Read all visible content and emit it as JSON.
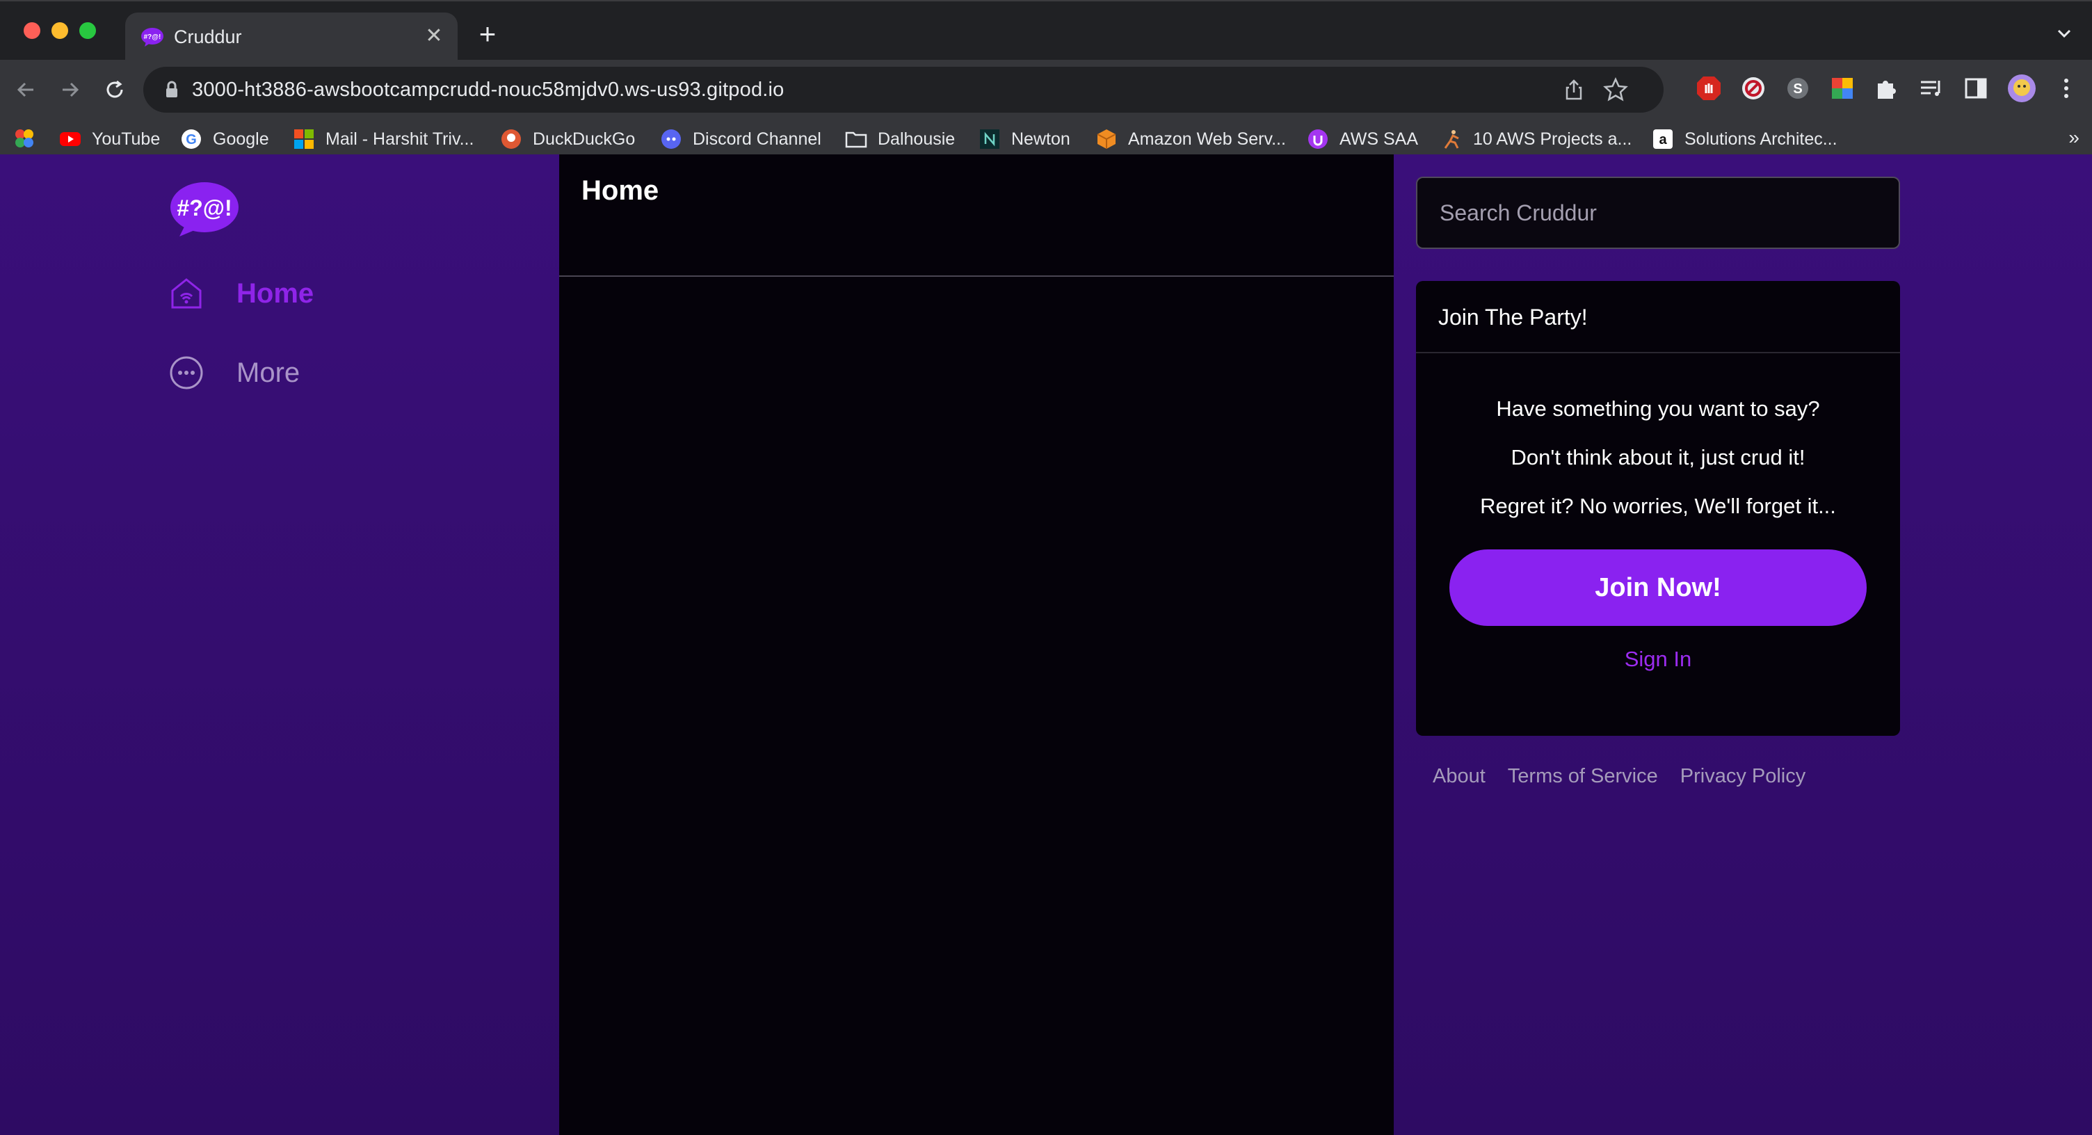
{
  "browser": {
    "tab_title": "Cruddur",
    "url": "3000-ht3886-awsbootcampcrudd-nouc58mjdv0.ws-us93.gitpod.io",
    "bookmarks": [
      {
        "label": "YouTube",
        "icon": "youtube-icon"
      },
      {
        "label": "Google",
        "icon": "google-icon"
      },
      {
        "label": "Mail - Harshit Triv...",
        "icon": "microsoft-icon"
      },
      {
        "label": "DuckDuckGo",
        "icon": "duckduckgo-icon"
      },
      {
        "label": "Discord Channel",
        "icon": "discord-icon"
      },
      {
        "label": "Dalhousie",
        "icon": "folder-icon"
      },
      {
        "label": "Newton",
        "icon": "newton-icon"
      },
      {
        "label": "Amazon Web Serv...",
        "icon": "aws-icon"
      },
      {
        "label": "AWS SAA",
        "icon": "udemy-icon"
      },
      {
        "label": "10 AWS Projects a...",
        "icon": "runner-icon"
      },
      {
        "label": "Solutions Architec...",
        "icon": "amazon-icon"
      }
    ],
    "more_bookmarks": "»"
  },
  "sidebar": {
    "logo_text": "#?@!",
    "items": [
      {
        "label": "Home",
        "icon": "home-icon",
        "active": true
      },
      {
        "label": "More",
        "icon": "more-icon",
        "active": false
      }
    ]
  },
  "feed": {
    "title": "Home"
  },
  "search": {
    "placeholder": "Search Cruddur"
  },
  "join": {
    "title": "Join The Party!",
    "lines": [
      "Have something you want to say?",
      "Don't think about it, just crud it!",
      "Regret it? No worries, We'll forget it..."
    ],
    "button": "Join Now!",
    "signin": "Sign In"
  },
  "footer": {
    "links": [
      "About",
      "Terms of Service",
      "Privacy Policy"
    ]
  },
  "colors": {
    "accent": "#8a22f0",
    "sidebar_bg": "#3a0f7a",
    "feed_bg": "#05020a"
  }
}
